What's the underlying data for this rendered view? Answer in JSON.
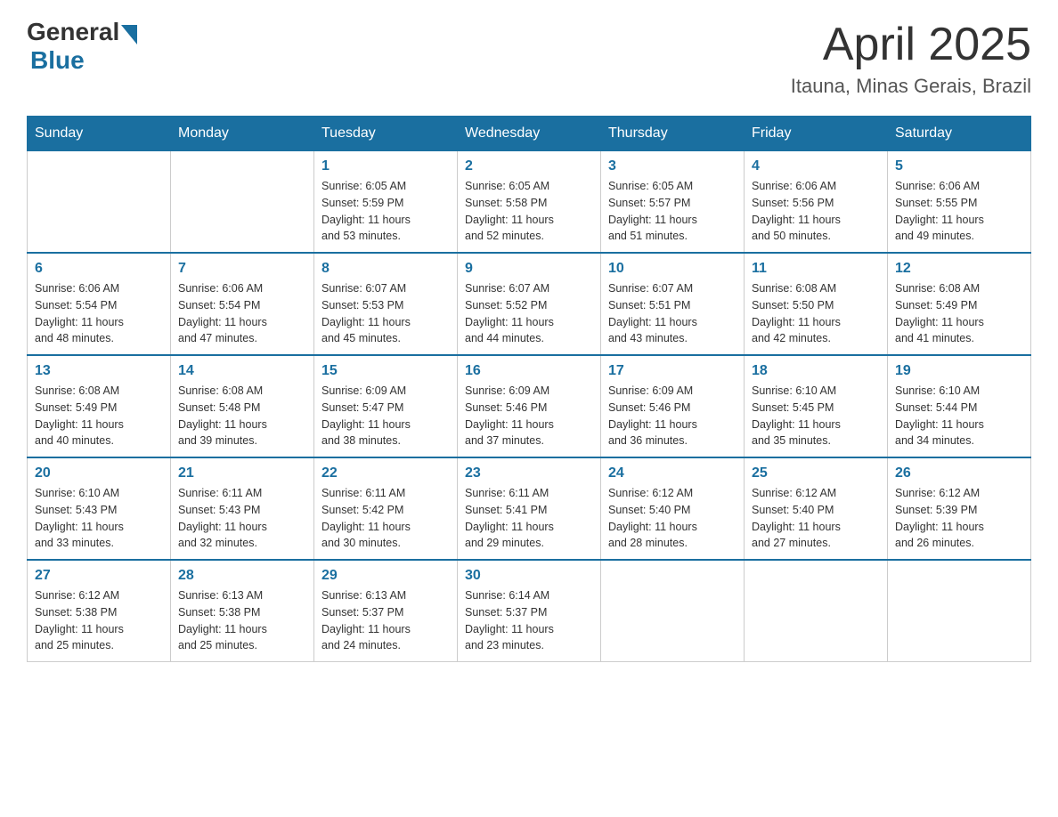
{
  "header": {
    "logo_general": "General",
    "logo_blue": "Blue",
    "month_title": "April 2025",
    "location": "Itauna, Minas Gerais, Brazil"
  },
  "days_of_week": [
    "Sunday",
    "Monday",
    "Tuesday",
    "Wednesday",
    "Thursday",
    "Friday",
    "Saturday"
  ],
  "weeks": [
    [
      {
        "day": "",
        "info": ""
      },
      {
        "day": "",
        "info": ""
      },
      {
        "day": "1",
        "info": "Sunrise: 6:05 AM\nSunset: 5:59 PM\nDaylight: 11 hours\nand 53 minutes."
      },
      {
        "day": "2",
        "info": "Sunrise: 6:05 AM\nSunset: 5:58 PM\nDaylight: 11 hours\nand 52 minutes."
      },
      {
        "day": "3",
        "info": "Sunrise: 6:05 AM\nSunset: 5:57 PM\nDaylight: 11 hours\nand 51 minutes."
      },
      {
        "day": "4",
        "info": "Sunrise: 6:06 AM\nSunset: 5:56 PM\nDaylight: 11 hours\nand 50 minutes."
      },
      {
        "day": "5",
        "info": "Sunrise: 6:06 AM\nSunset: 5:55 PM\nDaylight: 11 hours\nand 49 minutes."
      }
    ],
    [
      {
        "day": "6",
        "info": "Sunrise: 6:06 AM\nSunset: 5:54 PM\nDaylight: 11 hours\nand 48 minutes."
      },
      {
        "day": "7",
        "info": "Sunrise: 6:06 AM\nSunset: 5:54 PM\nDaylight: 11 hours\nand 47 minutes."
      },
      {
        "day": "8",
        "info": "Sunrise: 6:07 AM\nSunset: 5:53 PM\nDaylight: 11 hours\nand 45 minutes."
      },
      {
        "day": "9",
        "info": "Sunrise: 6:07 AM\nSunset: 5:52 PM\nDaylight: 11 hours\nand 44 minutes."
      },
      {
        "day": "10",
        "info": "Sunrise: 6:07 AM\nSunset: 5:51 PM\nDaylight: 11 hours\nand 43 minutes."
      },
      {
        "day": "11",
        "info": "Sunrise: 6:08 AM\nSunset: 5:50 PM\nDaylight: 11 hours\nand 42 minutes."
      },
      {
        "day": "12",
        "info": "Sunrise: 6:08 AM\nSunset: 5:49 PM\nDaylight: 11 hours\nand 41 minutes."
      }
    ],
    [
      {
        "day": "13",
        "info": "Sunrise: 6:08 AM\nSunset: 5:49 PM\nDaylight: 11 hours\nand 40 minutes."
      },
      {
        "day": "14",
        "info": "Sunrise: 6:08 AM\nSunset: 5:48 PM\nDaylight: 11 hours\nand 39 minutes."
      },
      {
        "day": "15",
        "info": "Sunrise: 6:09 AM\nSunset: 5:47 PM\nDaylight: 11 hours\nand 38 minutes."
      },
      {
        "day": "16",
        "info": "Sunrise: 6:09 AM\nSunset: 5:46 PM\nDaylight: 11 hours\nand 37 minutes."
      },
      {
        "day": "17",
        "info": "Sunrise: 6:09 AM\nSunset: 5:46 PM\nDaylight: 11 hours\nand 36 minutes."
      },
      {
        "day": "18",
        "info": "Sunrise: 6:10 AM\nSunset: 5:45 PM\nDaylight: 11 hours\nand 35 minutes."
      },
      {
        "day": "19",
        "info": "Sunrise: 6:10 AM\nSunset: 5:44 PM\nDaylight: 11 hours\nand 34 minutes."
      }
    ],
    [
      {
        "day": "20",
        "info": "Sunrise: 6:10 AM\nSunset: 5:43 PM\nDaylight: 11 hours\nand 33 minutes."
      },
      {
        "day": "21",
        "info": "Sunrise: 6:11 AM\nSunset: 5:43 PM\nDaylight: 11 hours\nand 32 minutes."
      },
      {
        "day": "22",
        "info": "Sunrise: 6:11 AM\nSunset: 5:42 PM\nDaylight: 11 hours\nand 30 minutes."
      },
      {
        "day": "23",
        "info": "Sunrise: 6:11 AM\nSunset: 5:41 PM\nDaylight: 11 hours\nand 29 minutes."
      },
      {
        "day": "24",
        "info": "Sunrise: 6:12 AM\nSunset: 5:40 PM\nDaylight: 11 hours\nand 28 minutes."
      },
      {
        "day": "25",
        "info": "Sunrise: 6:12 AM\nSunset: 5:40 PM\nDaylight: 11 hours\nand 27 minutes."
      },
      {
        "day": "26",
        "info": "Sunrise: 6:12 AM\nSunset: 5:39 PM\nDaylight: 11 hours\nand 26 minutes."
      }
    ],
    [
      {
        "day": "27",
        "info": "Sunrise: 6:12 AM\nSunset: 5:38 PM\nDaylight: 11 hours\nand 25 minutes."
      },
      {
        "day": "28",
        "info": "Sunrise: 6:13 AM\nSunset: 5:38 PM\nDaylight: 11 hours\nand 25 minutes."
      },
      {
        "day": "29",
        "info": "Sunrise: 6:13 AM\nSunset: 5:37 PM\nDaylight: 11 hours\nand 24 minutes."
      },
      {
        "day": "30",
        "info": "Sunrise: 6:14 AM\nSunset: 5:37 PM\nDaylight: 11 hours\nand 23 minutes."
      },
      {
        "day": "",
        "info": ""
      },
      {
        "day": "",
        "info": ""
      },
      {
        "day": "",
        "info": ""
      }
    ]
  ]
}
